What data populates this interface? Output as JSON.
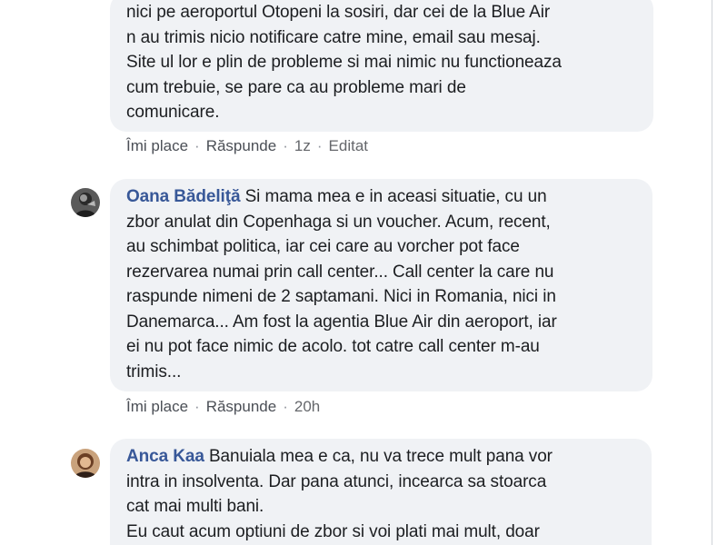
{
  "comments": [
    {
      "author": "",
      "lines": [
        "nici pe aeroportul Otopeni la sosiri, dar cei de la Blue Air",
        "n au trimis nicio notificare catre mine, email sau mesaj.",
        "Site ul lor e plin de probleme si mai nimic nu functioneaza",
        "cum trebuie, se pare ca au probleme mari de",
        "comunicare."
      ],
      "like_label": "Îmi place",
      "reply_label": "Răspunde",
      "time": "1z",
      "edited_label": "Editat"
    },
    {
      "author": "Oana Bădeliţă",
      "first_line": " Si mama mea e in aceasi situatie, cu un",
      "lines": [
        "zbor anulat din Copenhaga si un voucher. Acum, recent,",
        "au schimbat politica, iar cei care au vorcher pot face",
        "rezervarea numai prin call center... Call center la care nu",
        "raspunde nimeni de 2 saptamani. Nici in Romania, nici in",
        "Danemarca... Am fost la agentia Blue Air din aeroport, iar",
        "ei nu pot face nimic de acolo. tot catre call center m-au",
        "trimis..."
      ],
      "like_label": "Îmi place",
      "reply_label": "Răspunde",
      "time": "20h"
    },
    {
      "author": "Anca Kaa",
      "first_line": " Banuiala mea e ca, nu va trece mult pana vor",
      "lines": [
        "intra in insolventa. Dar pana atunci, incearca sa stoarca",
        "cat mai multi bani.",
        "Eu caut acum optiuni de zbor si voi plati mai mult, doar"
      ]
    }
  ],
  "separator": "·",
  "colors": {
    "bubble": "#f0f2f5",
    "author": "#385898",
    "meta": "#65676b"
  }
}
